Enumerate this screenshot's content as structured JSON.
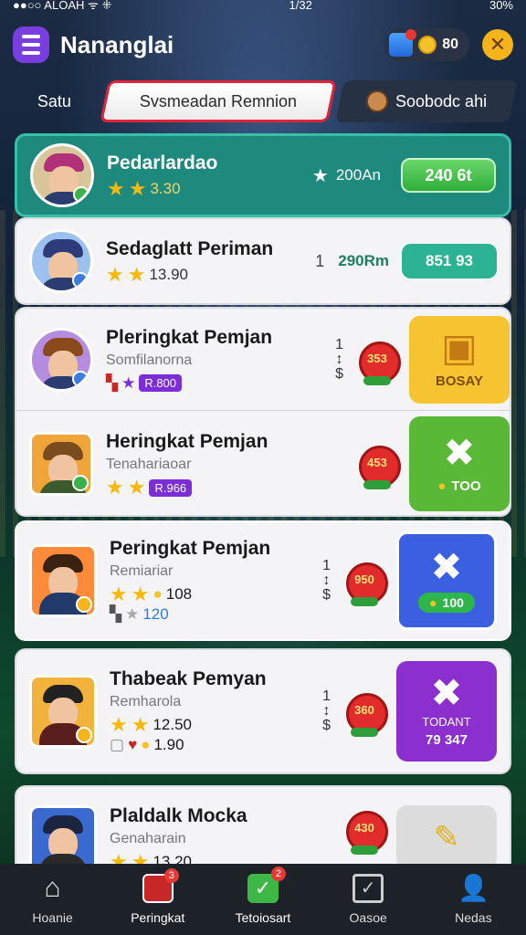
{
  "status": {
    "left": "●●○○ ALOAH ᯤ ⁜",
    "time": "1/32",
    "right": "30%"
  },
  "header": {
    "title": "Nananglai",
    "coins": "80"
  },
  "tabs": [
    {
      "label": "Satu"
    },
    {
      "label": "Svsmeadan Remnion"
    },
    {
      "label": "Soobodc ahi"
    }
  ],
  "rows": [
    {
      "name": "Pedarlardao",
      "rating": "3.30",
      "points": "200An",
      "button": "240 6t",
      "variant": "top"
    },
    {
      "name": "Sedaglatt Periman",
      "rating": "13.90",
      "rank": "1",
      "points": "290Rm",
      "button": "851 93"
    },
    {
      "name": "Pleringkat Pemjan",
      "sub": "Somfilanorna",
      "tag": "R.800",
      "medal": "353",
      "action": "BOSAY",
      "action_color": "yellow"
    },
    {
      "name": "Heringkat Pemjan",
      "sub": "Tenahariaoar",
      "tag": "R.966",
      "medal": "453",
      "action": "TOO",
      "action_color": "green"
    },
    {
      "name": "Peringkat Pemjan",
      "sub": "Remiariar",
      "rating": "108",
      "rating2": "120",
      "medal": "950",
      "action": "100",
      "action_color": "blue"
    },
    {
      "name": "Thabeak Pemyan",
      "sub": "Remharola",
      "rating": "12.50",
      "rating2": "1.90",
      "medal": "360",
      "action": "TODANT",
      "action2": "79 347",
      "action_color": "purple"
    },
    {
      "name": "Plaldalk Mocka",
      "sub": "Genaharain",
      "rating": "13.20",
      "medal": "430",
      "action_color": "gray"
    }
  ],
  "nav": [
    {
      "label": "Hoanie"
    },
    {
      "label": "Peringkat",
      "badge": "3"
    },
    {
      "label": "Tetoiosart",
      "badge": "2"
    },
    {
      "label": "Oasoe"
    },
    {
      "label": "Nedas"
    }
  ]
}
